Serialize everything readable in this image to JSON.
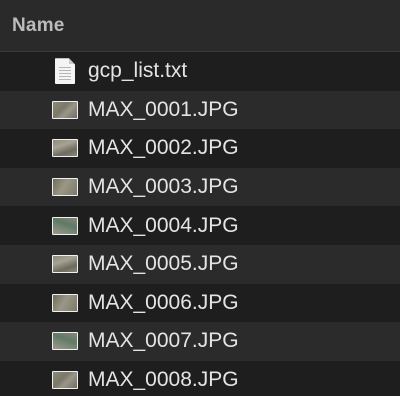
{
  "header": {
    "name_column": "Name"
  },
  "files": [
    {
      "name": "gcp_list.txt",
      "icon": "text-file-icon"
    },
    {
      "name": "MAX_0001.JPG",
      "icon": "image-file-icon"
    },
    {
      "name": "MAX_0002.JPG",
      "icon": "image-file-icon"
    },
    {
      "name": "MAX_0003.JPG",
      "icon": "image-file-icon"
    },
    {
      "name": "MAX_0004.JPG",
      "icon": "image-file-icon"
    },
    {
      "name": "MAX_0005.JPG",
      "icon": "image-file-icon"
    },
    {
      "name": "MAX_0006.JPG",
      "icon": "image-file-icon"
    },
    {
      "name": "MAX_0007.JPG",
      "icon": "image-file-icon"
    },
    {
      "name": "MAX_0008.JPG",
      "icon": "image-file-icon"
    }
  ],
  "colors": {
    "background": "#1e1e1e",
    "alternate_row": "#2b2b2b",
    "header_bg": "#2a2a2a",
    "text": "#e4e4e4"
  }
}
